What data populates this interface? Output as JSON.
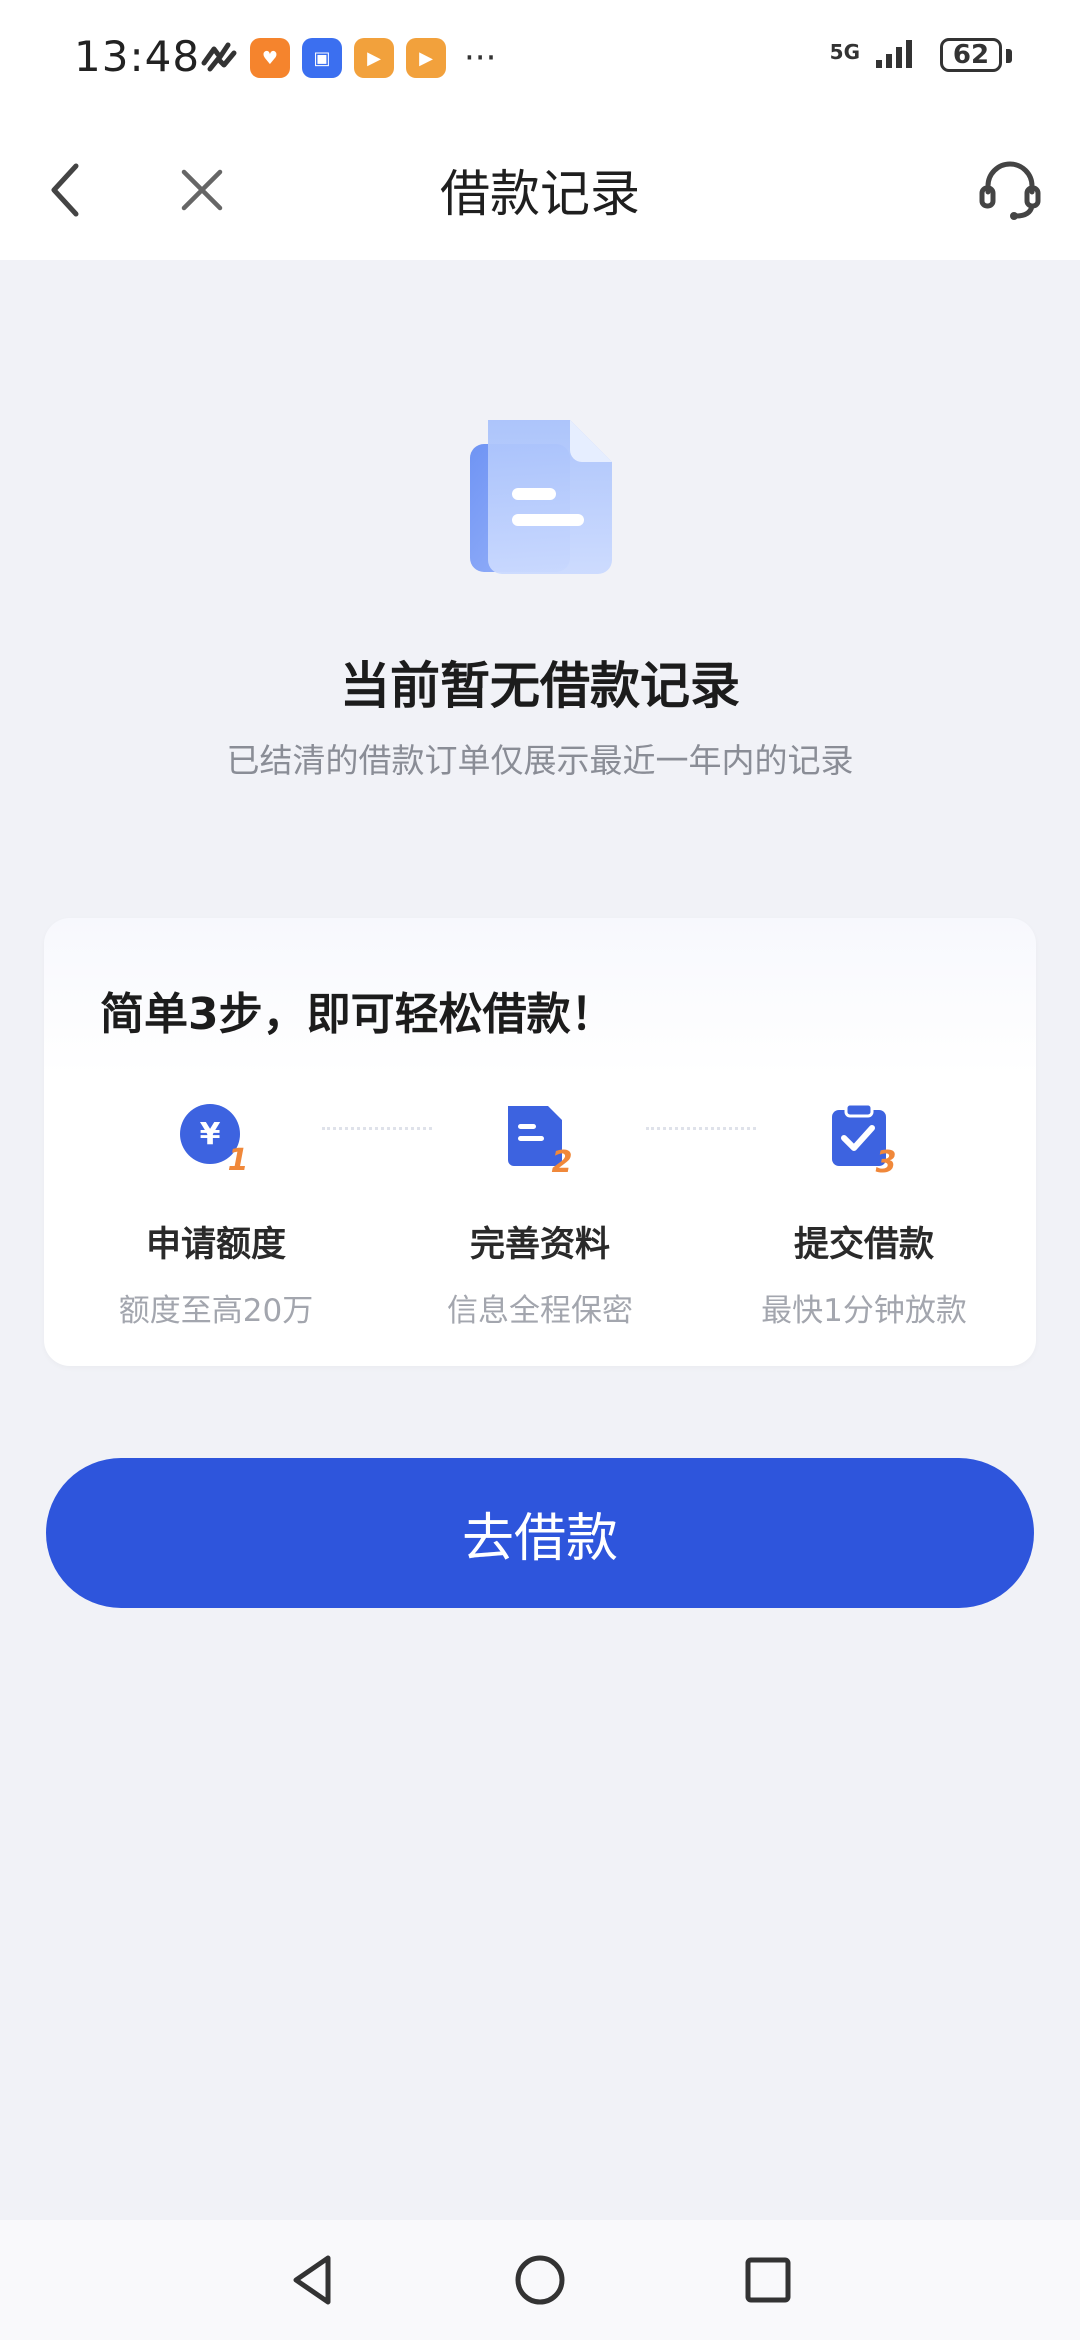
{
  "status_bar": {
    "time": "13:48",
    "notification_icons": [
      "activity-icon",
      "health-app-icon",
      "app-market-icon",
      "video-app-icon",
      "video-app-icon"
    ],
    "more_indicator": "···",
    "network": "5G",
    "battery": "62"
  },
  "nav": {
    "title": "借款记录",
    "back_icon": "chevron-left-icon",
    "close_icon": "close-icon",
    "service_icon": "headset-icon"
  },
  "empty_state": {
    "title": "当前暂无借款记录",
    "subtitle": "已结清的借款订单仅展示最近一年内的记录"
  },
  "steps_card": {
    "title": "简单3步，即可轻松借款！",
    "steps": [
      {
        "number": "1",
        "icon": "yen-coin-icon",
        "label": "申请额度",
        "desc": "额度至高20万"
      },
      {
        "number": "2",
        "icon": "document-icon",
        "label": "完善资料",
        "desc": "信息全程保密"
      },
      {
        "number": "3",
        "icon": "clipboard-check-icon",
        "label": "提交借款",
        "desc": "最快1分钟放款"
      }
    ]
  },
  "cta": {
    "label": "去借款"
  },
  "colors": {
    "primary": "#2e55dc",
    "page_bg": "#f1f2f7",
    "accent_orange": "#f0883a",
    "icon_blue": "#3d63e0"
  }
}
